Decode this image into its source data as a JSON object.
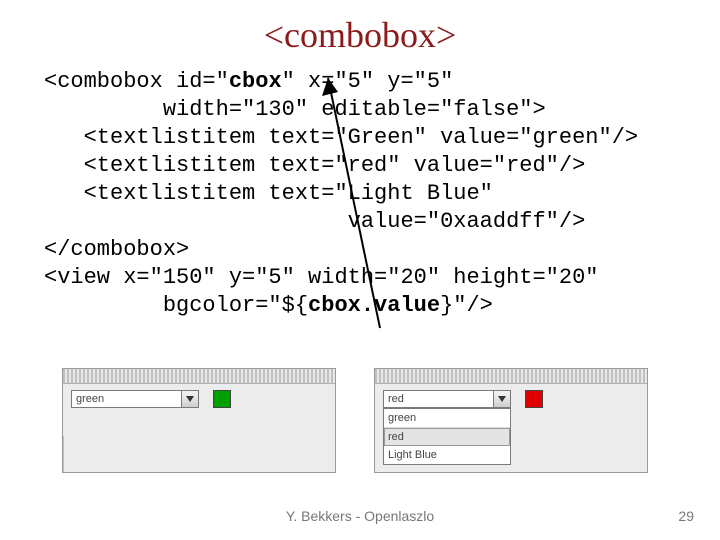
{
  "title": "<combobox>",
  "code": {
    "l1a": "<combobox id=\"",
    "l1b": "cbox",
    "l1c": "\" x=\"5\" y=\"5\"",
    "l2": "         width=\"130\" editable=\"false\">",
    "l3": "   <textlistitem text=\"Green\" value=\"green\"/>",
    "l4": "   <textlistitem text=\"red\" value=\"red\"/>",
    "l5": "   <textlistitem text=\"Light Blue\"",
    "l6": "                       value=\"0xaaddff\"/>",
    "l7": "</combobox>",
    "l8": "<view x=\"150\" y=\"5\" width=\"20\" height=\"20\"",
    "l9a": "         bgcolor=\"${",
    "l9b": "cbox.value",
    "l9c": "}\"/>"
  },
  "demo_left": {
    "selected": "green"
  },
  "demo_right": {
    "selected": "red",
    "items": [
      "green",
      "red",
      "Light Blue"
    ]
  },
  "footer": {
    "author": "Y. Bekkers - Openlaszlo",
    "page": "29"
  }
}
